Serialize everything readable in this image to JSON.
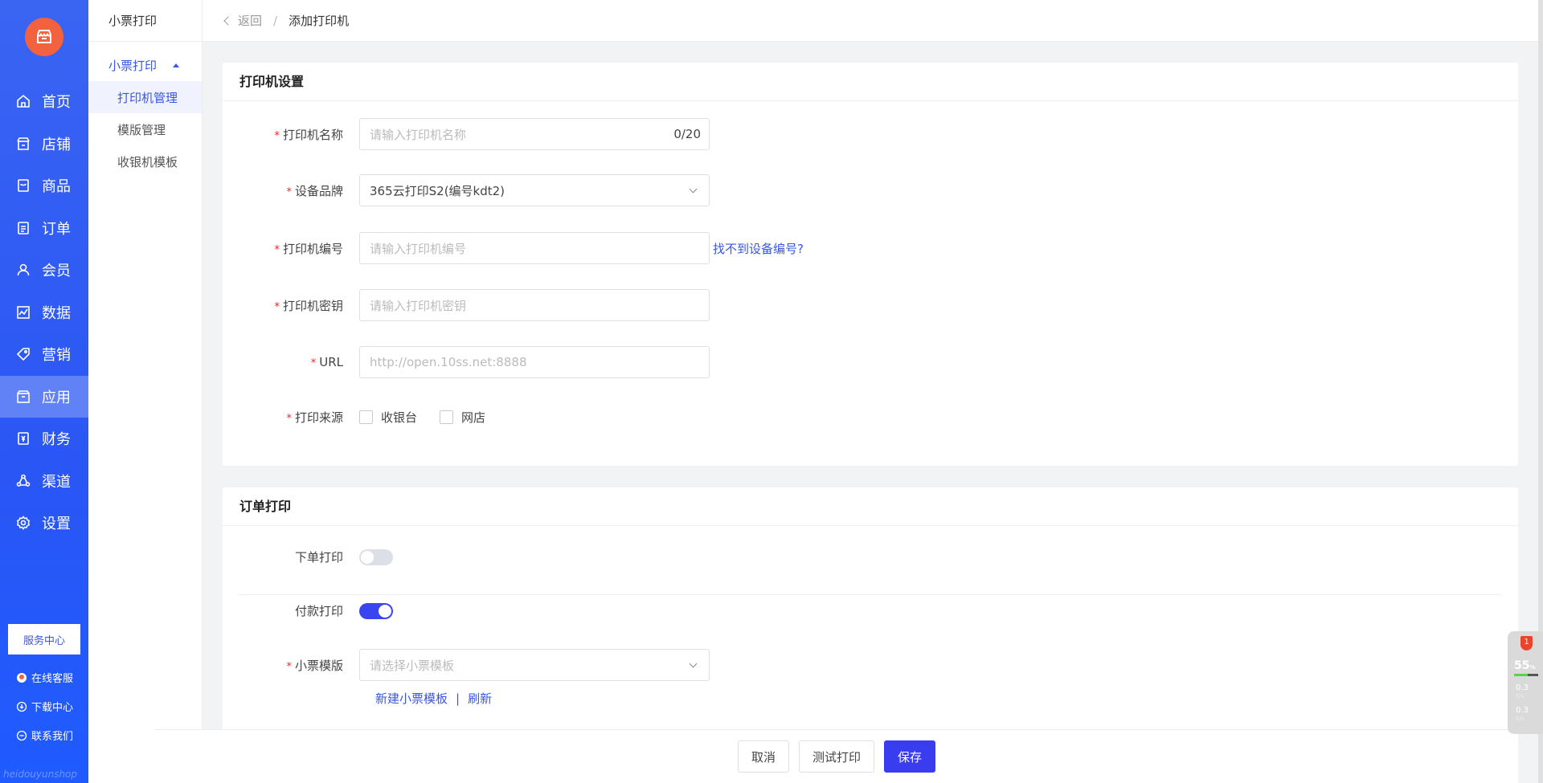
{
  "sidebar": {
    "items": [
      {
        "label": "首页",
        "icon": "home-icon"
      },
      {
        "label": "店铺",
        "icon": "store-icon"
      },
      {
        "label": "商品",
        "icon": "goods-icon"
      },
      {
        "label": "订单",
        "icon": "order-icon"
      },
      {
        "label": "会员",
        "icon": "member-icon"
      },
      {
        "label": "数据",
        "icon": "chart-icon"
      },
      {
        "label": "营销",
        "icon": "tag-icon"
      },
      {
        "label": "应用",
        "icon": "app-icon",
        "active": true
      },
      {
        "label": "财务",
        "icon": "finance-icon"
      },
      {
        "label": "渠道",
        "icon": "channel-icon"
      },
      {
        "label": "设置",
        "icon": "gear-icon"
      }
    ],
    "service_center": "服务中心",
    "online_support": "在线客服",
    "download_center": "下载中心",
    "contact_us": "联系我们",
    "watermark": "heidouyunshop"
  },
  "subnav": {
    "title": "小票打印",
    "group": "小票打印",
    "items": [
      "打印机管理",
      "模版管理",
      "收银机模板"
    ]
  },
  "breadcrumb": {
    "back": "返回",
    "separator": "/",
    "current": "添加打印机"
  },
  "printer_settings": {
    "title": "打印机设置",
    "name_label": "打印机名称",
    "name_placeholder": "请输入打印机名称",
    "name_count": "0/20",
    "brand_label": "设备品牌",
    "brand_value": "365云打印S2(编号kdt2)",
    "number_label": "打印机编号",
    "number_placeholder": "请输入打印机编号",
    "number_help": "找不到设备编号?",
    "key_label": "打印机密钥",
    "key_placeholder": "请输入打印机密钥",
    "url_label": "URL",
    "url_placeholder": "http://open.10ss.net:8888",
    "source_label": "打印来源",
    "source_options": [
      "收银台",
      "网店"
    ]
  },
  "order_print": {
    "title": "订单打印",
    "place_order_label": "下单打印",
    "place_order_on": false,
    "payment_label": "付款打印",
    "payment_on": true,
    "template_label": "小票模版",
    "template_placeholder": "请选择小票模板",
    "new_template": "新建小票模板",
    "link_sep": "|",
    "refresh": "刷新"
  },
  "footer": {
    "cancel": "取消",
    "test_print": "测试打印",
    "save": "保存"
  },
  "widget": {
    "badge": "1",
    "percent": "55",
    "percent_unit": "%",
    "up_speed": "0.3",
    "down_speed": "0.3",
    "speed_unit": "K/s"
  },
  "colors": {
    "accent": "#3a56e4",
    "primary_button": "#3a3cf0",
    "logo": "#f2623f",
    "required": "#f5222d"
  }
}
